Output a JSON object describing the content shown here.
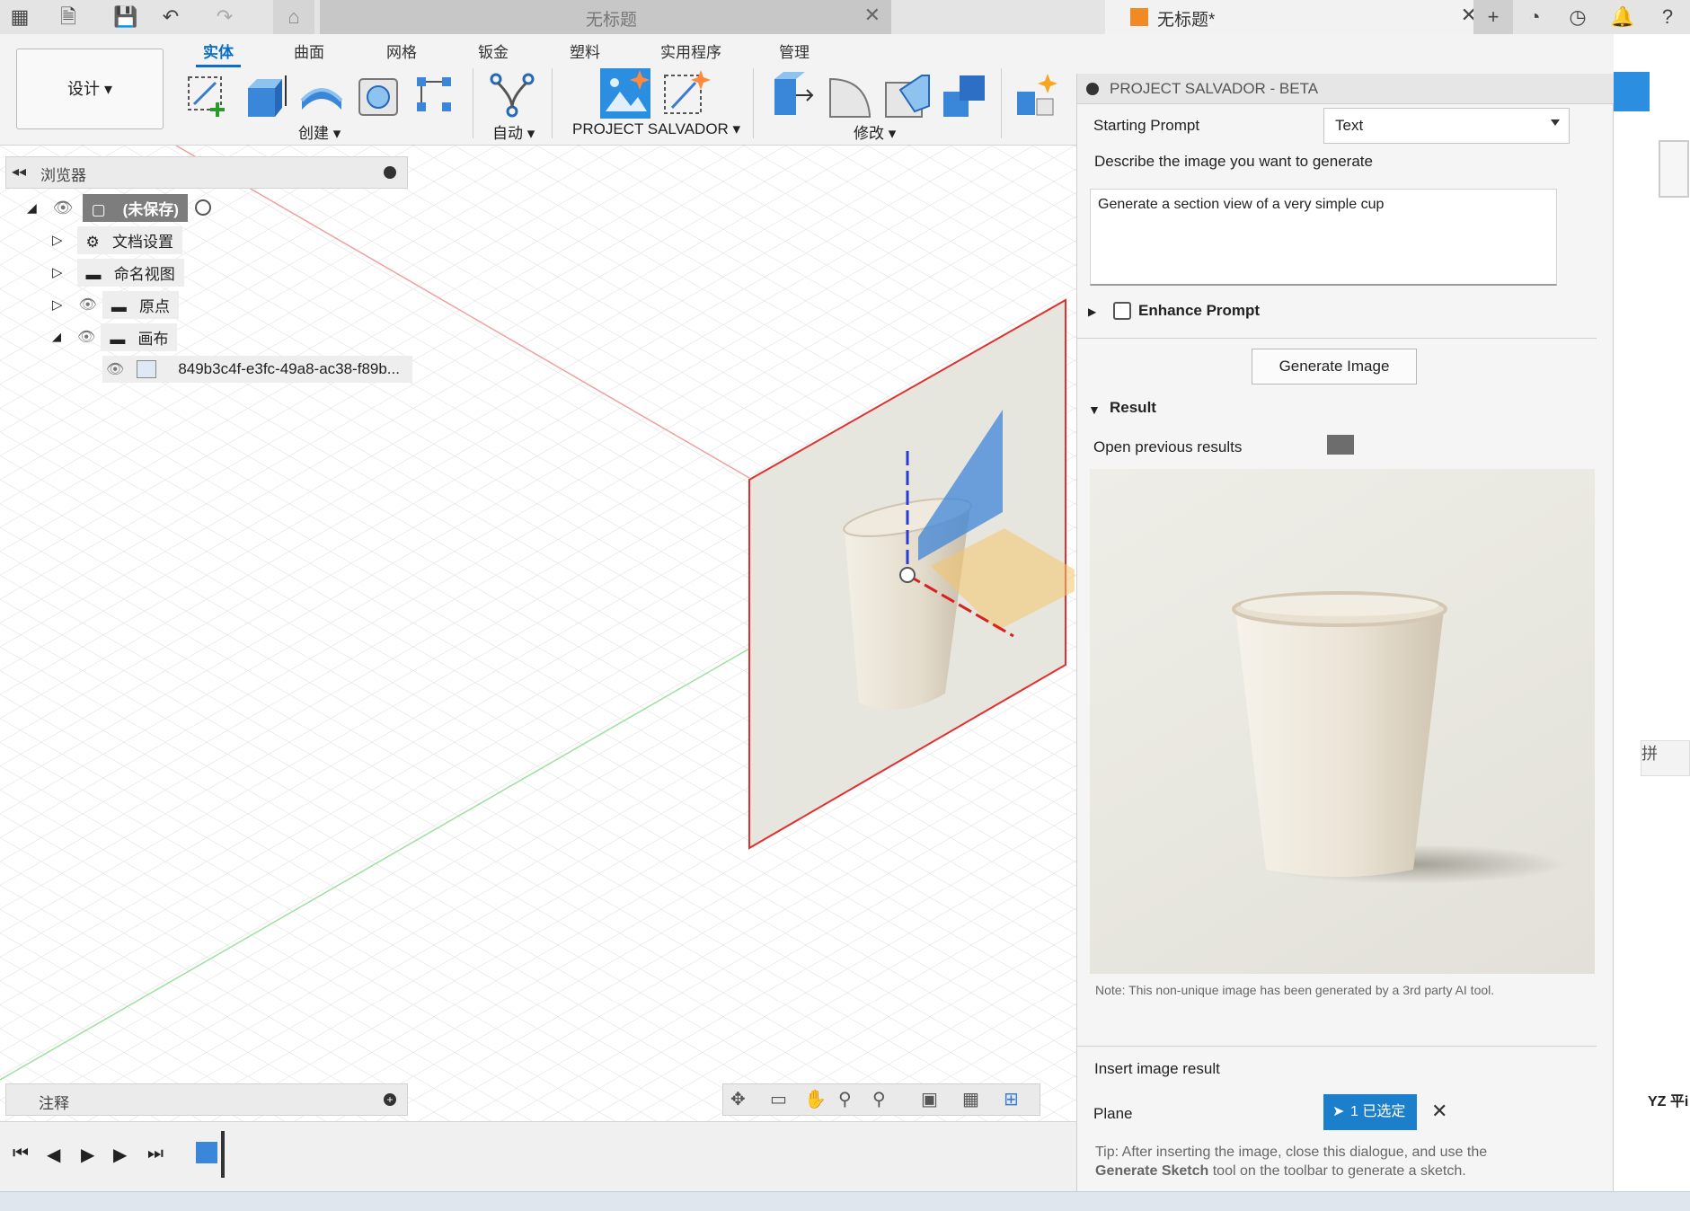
{
  "titlebar": {
    "tab1_title": "无标题",
    "tab2_title": "无标题*"
  },
  "ribbon": {
    "design_label": "设计",
    "tabs": [
      "实体",
      "曲面",
      "网格",
      "钣金",
      "塑料",
      "实用程序",
      "管理"
    ],
    "groups": {
      "create": "创建",
      "automate": "自动",
      "salvador": "PROJECT SALVADOR",
      "modify": "修改"
    }
  },
  "browser": {
    "title": "浏览器",
    "root_label": "(未保存)",
    "items": [
      "文档设置",
      "命名视图",
      "原点",
      "画布"
    ],
    "canvas_item": "849b3c4f-e3fc-49a8-ac38-f89b..."
  },
  "comments": {
    "title": "注释"
  },
  "viewport": {
    "plane_label": "YZ 平i"
  },
  "panel": {
    "title": "PROJECT SALVADOR - BETA",
    "starting_prompt_label": "Starting Prompt",
    "starting_prompt_value": "Text",
    "describe_label": "Describe the image you want to generate",
    "prompt_text": "Generate a section view of a very simple cup",
    "enhance_label": "Enhance Prompt",
    "generate_button": "Generate Image",
    "result_label": "Result",
    "open_previous_label": "Open previous results",
    "note": "Note: This non-unique image has been generated by a 3rd party AI tool.",
    "insert_label": "Insert image result",
    "plane_label": "Plane",
    "selected_label": "1 已选定",
    "tip_prefix": "Tip: After inserting the image, close this dialogue, and use the",
    "tip_bold": "Generate Sketch",
    "tip_suffix": "tool on the toolbar to generate a sketch."
  },
  "colors": {
    "accent": "#0a6fc2",
    "selection": "#1b7fcc"
  }
}
